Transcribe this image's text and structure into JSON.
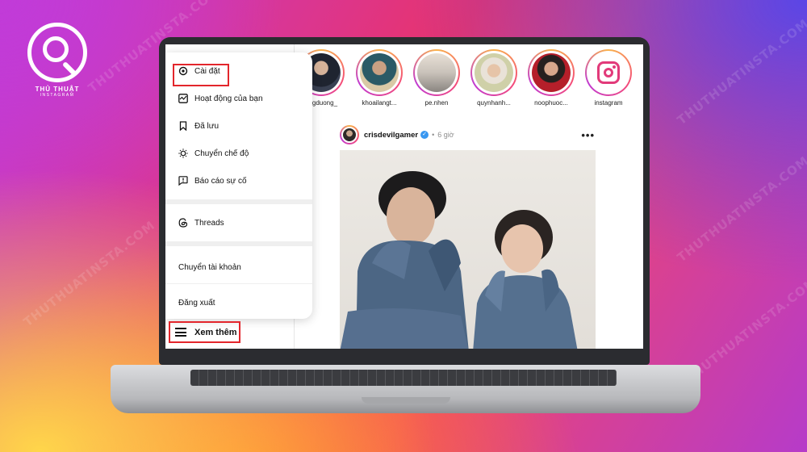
{
  "logo": {
    "line1": "THỦ THUẬT",
    "line2": "INSTAGRAM"
  },
  "watermark_text": "THUTHUATINSTA.COM",
  "menu": {
    "settings": "Cài đặt",
    "activity": "Hoạt động của bạn",
    "saved": "Đã lưu",
    "switch_mode": "Chuyển chế độ",
    "report": "Báo cáo sự cố",
    "threads": "Threads",
    "switch_account": "Chuyển tài khoản",
    "logout": "Đăng xuất"
  },
  "more_label": "Xem thêm",
  "stories": [
    {
      "name": "ungduong_"
    },
    {
      "name": "khoailangt..."
    },
    {
      "name": "pe.nhen"
    },
    {
      "name": "quynhanh..."
    },
    {
      "name": "noophuoc..."
    },
    {
      "name": "instagram"
    }
  ],
  "post": {
    "username": "crisdevilgamer",
    "verified_mark": "✓",
    "separator": "•",
    "time": "6 giờ",
    "more": "•••"
  },
  "colors": {
    "highlight": "#e3262c",
    "verified": "#3897f0"
  }
}
